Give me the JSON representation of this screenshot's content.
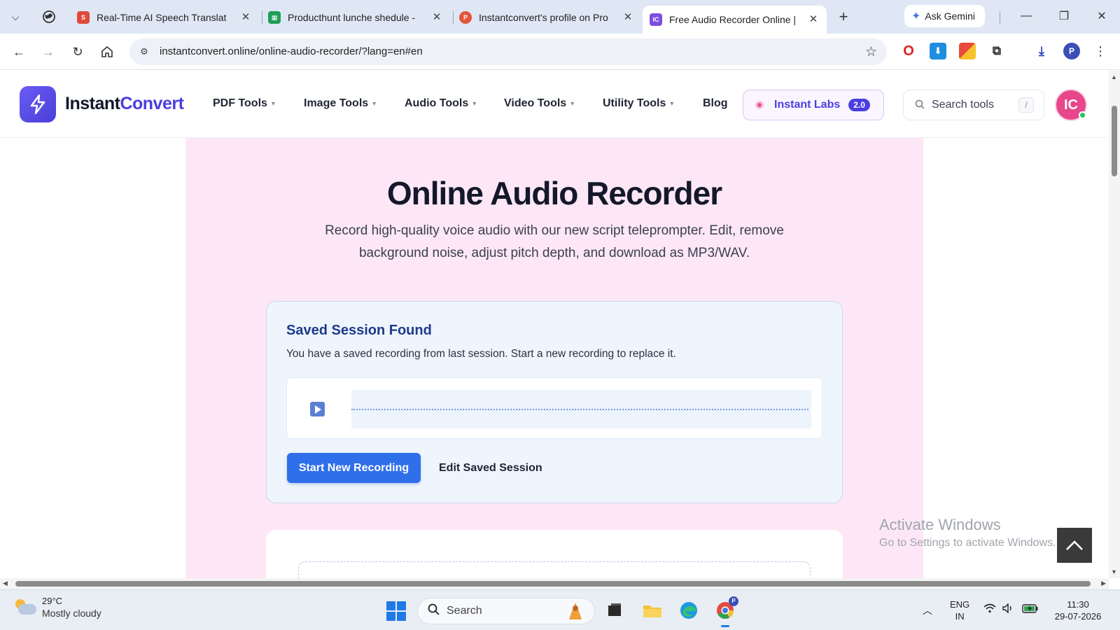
{
  "browser": {
    "tabs": [
      {
        "title": "Real-Time AI Speech Translator",
        "favicon": "s-icon",
        "color": "#e04a3a"
      },
      {
        "title": "Producthunt lunche shedule -",
        "favicon": "sheets-icon",
        "color": "#1e9e56"
      },
      {
        "title": "Instantconvert's profile on Pro",
        "favicon": "producthunt-icon",
        "color": "#e2553b"
      },
      {
        "title": "Free Audio Recorder Online | F",
        "favicon": "instantconvert-icon",
        "color": "#7b4fe0"
      }
    ],
    "new_tab_label": "+",
    "gemini_label": "Ask Gemini",
    "url": "instantconvert.online/online-audio-recorder/?lang=en#en",
    "profile_initial": "P"
  },
  "site": {
    "brand_part1": "Instant",
    "brand_part2": "Convert",
    "nav": [
      "PDF Tools",
      "Image Tools",
      "Audio Tools",
      "Video Tools",
      "Utility Tools",
      "Blog"
    ],
    "labs_label": "Instant Labs",
    "labs_badge": "2.0",
    "search_placeholder": "Search tools",
    "search_shortcut": "/",
    "avatar_initials": "IC",
    "accent_color": "#4b3ee0"
  },
  "hero": {
    "title": "Online Audio Recorder",
    "subtitle": "Record high-quality voice audio with our new script teleprompter. Edit, remove background noise, adjust pitch depth, and download as MP3/WAV."
  },
  "session": {
    "title": "Saved Session Found",
    "description": "You have a saved recording from last session. Start a new recording to replace it.",
    "start_button": "Start New Recording",
    "edit_button": "Edit Saved Session"
  },
  "watermark": {
    "line1": "Activate Windows",
    "line2": "Go to Settings to activate Windows."
  },
  "taskbar": {
    "temperature": "29°C",
    "condition": "Mostly cloudy",
    "search_label": "Search",
    "language": "ENG",
    "region": "IN",
    "time": "11:30",
    "date": "29-07-2026"
  }
}
